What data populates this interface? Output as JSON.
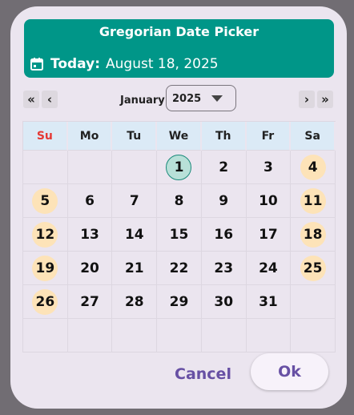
{
  "header": {
    "title": "Gregorian Date Picker",
    "today_label": "Today:",
    "today_value": "August 18, 2025",
    "icon": "calendar-icon",
    "color": "#009688"
  },
  "nav": {
    "first": "«",
    "prev": "‹",
    "next": "›",
    "last": "»",
    "month": "January",
    "year": "2025"
  },
  "weekdays": [
    "Su",
    "Mo",
    "Tu",
    "We",
    "Th",
    "Fr",
    "Sa"
  ],
  "days": [
    [
      "",
      "",
      "",
      "1",
      "2",
      "3",
      "4"
    ],
    [
      "5",
      "6",
      "7",
      "8",
      "9",
      "10",
      "11"
    ],
    [
      "12",
      "13",
      "14",
      "15",
      "16",
      "17",
      "18"
    ],
    [
      "19",
      "20",
      "21",
      "22",
      "23",
      "24",
      "25"
    ],
    [
      "26",
      "27",
      "28",
      "29",
      "30",
      "31",
      ""
    ],
    [
      "",
      "",
      "",
      "",
      "",
      "",
      ""
    ]
  ],
  "selected_day": "1",
  "actions": {
    "cancel": "Cancel",
    "ok": "Ok"
  },
  "colors": {
    "weekend": "#fde3b8",
    "selected": "#b8e0d8",
    "sunday_header": "#e53935",
    "action": "#6750a4"
  }
}
